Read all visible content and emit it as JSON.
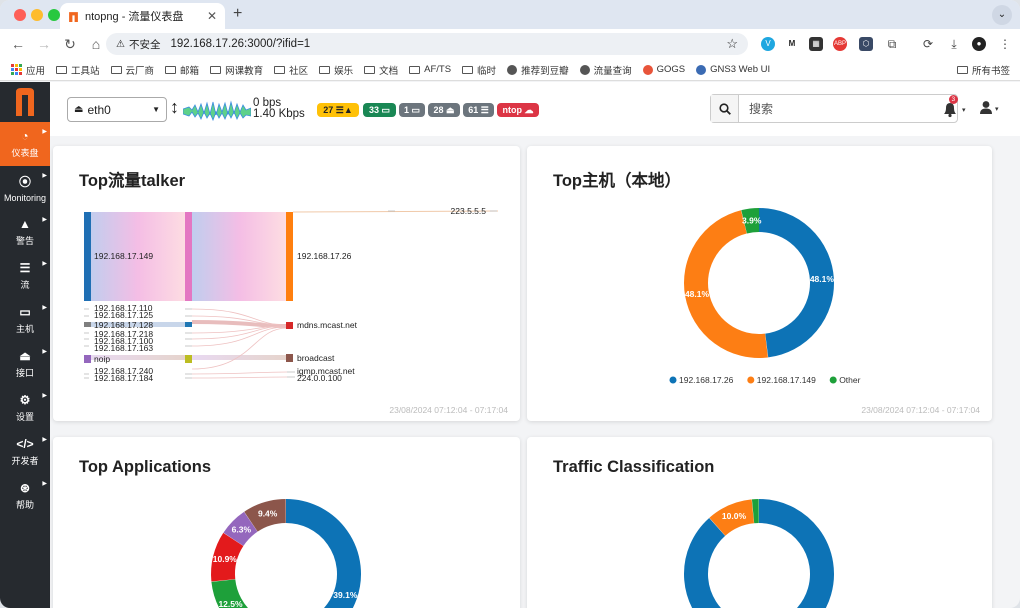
{
  "browser": {
    "tab_title": "ntopng - 流量仪表盘",
    "url": "192.168.17.26:3000/?ifid=1",
    "not_secure": "不安全"
  },
  "bookmarks": [
    "应用",
    "工具站",
    "云厂商",
    "邮箱",
    "网课教育",
    "社区",
    "娱乐",
    "文档",
    "AF/TS",
    "临时",
    "推荐到豆瓣",
    "流量查询",
    "GOGS",
    "GNS3 Web UI"
  ],
  "bookmarks_right": "所有书签",
  "sidebar": {
    "logo": "n",
    "items": [
      {
        "label": "仪表盘",
        "icon": "gauge-icon"
      },
      {
        "label": "Monitoring",
        "icon": "radar-icon"
      },
      {
        "label": "警告",
        "icon": "warning-icon"
      },
      {
        "label": "流",
        "icon": "list-icon"
      },
      {
        "label": "主机",
        "icon": "laptop-icon"
      },
      {
        "label": "接口",
        "icon": "ethernet-icon"
      },
      {
        "label": "设置",
        "icon": "gear-icon"
      },
      {
        "label": "开发者",
        "icon": "code-icon"
      },
      {
        "label": "帮助",
        "icon": "lifering-icon"
      }
    ]
  },
  "header": {
    "interface": "eth0",
    "rate_down": "0 bps",
    "rate_up": "1.40 Kbps",
    "badges": [
      {
        "text": "27",
        "icon": "list-warning-icon",
        "color": "#ffc107",
        "text_color": "#222"
      },
      {
        "text": "33",
        "icon": "laptop-icon",
        "color": "#198754"
      },
      {
        "text": "1",
        "icon": "laptop-icon",
        "color": "#6c757d"
      },
      {
        "text": "28",
        "icon": "ethernet-icon",
        "color": "#6c757d"
      },
      {
        "text": "61",
        "icon": "list-icon",
        "color": "#6c757d"
      },
      {
        "text": "ntop",
        "icon": "cloud-icon",
        "color": "#dc3545"
      }
    ],
    "search_placeholder": "搜索",
    "alert_count": "3"
  },
  "cards": {
    "talker": {
      "title": "Top流量talker",
      "time": "23/08/2024 07:12:04 - 07:17:04"
    },
    "hosts": {
      "title": "Top主机（本地）",
      "time": "23/08/2024 07:12:04 - 07:17:04"
    },
    "apps": {
      "title": "Top Applications"
    },
    "classification": {
      "title": "Traffic Classification"
    }
  },
  "sankey": {
    "sources": [
      "192.168.17.149",
      "192.168.17.110",
      "192.168.17.125",
      "192.168.17.128",
      "192.168.17.218",
      "192.168.17.100",
      "192.168.17.163",
      "noip",
      "192.168.17.240",
      "192.168.17.184"
    ],
    "targets": [
      "223.5.5.5",
      "192.168.17.26",
      "mdns.mcast.net",
      "broadcast",
      "igmp.mcast.net",
      "224.0.0.100"
    ]
  },
  "chart_data": [
    {
      "type": "pie",
      "title": "Top主机（本地）",
      "series": [
        {
          "label": "192.168.17.26",
          "value": 48.1,
          "color": "#0d73b6"
        },
        {
          "label": "192.168.17.149",
          "value": 48.1,
          "color": "#fd7e14"
        },
        {
          "label": "Other",
          "value": 3.9,
          "color": "#1ea03a"
        }
      ]
    },
    {
      "type": "pie",
      "title": "Top Applications",
      "series": [
        {
          "label": "",
          "value": 39.1,
          "color": "#0d73b6"
        },
        {
          "label": "",
          "value": 12.5,
          "color": "#1ea03a"
        },
        {
          "label": "",
          "value": 10.9,
          "color": "#e31a1c"
        },
        {
          "label": "",
          "value": 6.3,
          "color": "#9467bd"
        },
        {
          "label": "",
          "value": 9.4,
          "color": "#8c564b"
        }
      ]
    },
    {
      "type": "pie",
      "title": "Traffic Classification",
      "series": [
        {
          "label": "",
          "value": 10.0,
          "color": "#fd7e14"
        },
        {
          "label": "",
          "value": 1.5,
          "color": "#1ea03a"
        }
      ]
    }
  ]
}
